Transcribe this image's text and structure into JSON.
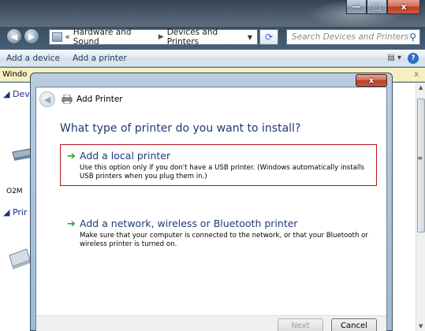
{
  "window": {
    "caption_minimize": "—",
    "caption_maximize": "□",
    "caption_close": "x"
  },
  "address_bar": {
    "prefix": "«",
    "crumbs": [
      "Hardware and Sound",
      "Devices and Printers"
    ],
    "separator": "▶",
    "dropdown": "▼"
  },
  "search": {
    "placeholder": "Search Devices and Printers"
  },
  "command_bar": {
    "add_device": "Add a device",
    "add_printer": "Add a printer",
    "help": "?"
  },
  "info_bar": {
    "text_visible": "Windo",
    "close": "x"
  },
  "explorer": {
    "group_devices": "◢ Dev",
    "group_printers": "◢ Prir",
    "device_label": "O2M",
    "side_marker": "≡"
  },
  "dialog": {
    "title": "Add Printer",
    "close": "x",
    "question": "What type of printer do you want to install?",
    "options": [
      {
        "title": "Add a local printer",
        "description": "Use this option only if you don't have a USB printer. (Windows automatically installs USB printers when you plug them in.)",
        "selected": true
      },
      {
        "title": "Add a network, wireless or Bluetooth printer",
        "description": "Make sure that your computer is connected to the network, or that your Bluetooth or wireless printer is turned on.",
        "selected": false
      }
    ],
    "buttons": {
      "next": "Next",
      "cancel": "Cancel"
    }
  },
  "icons": {
    "back": "back-arrow-icon",
    "forward": "forward-arrow-icon",
    "refresh": "refresh-icon",
    "search": "search-icon",
    "printer": "printer-icon",
    "option_arrow": "green-arrow-icon",
    "help": "help-icon"
  },
  "colors": {
    "selection_border": "#b4151b",
    "option_arrow": "#2aa63a",
    "heading_text": "#1e3a78",
    "info_bar": "#f6efbf"
  }
}
